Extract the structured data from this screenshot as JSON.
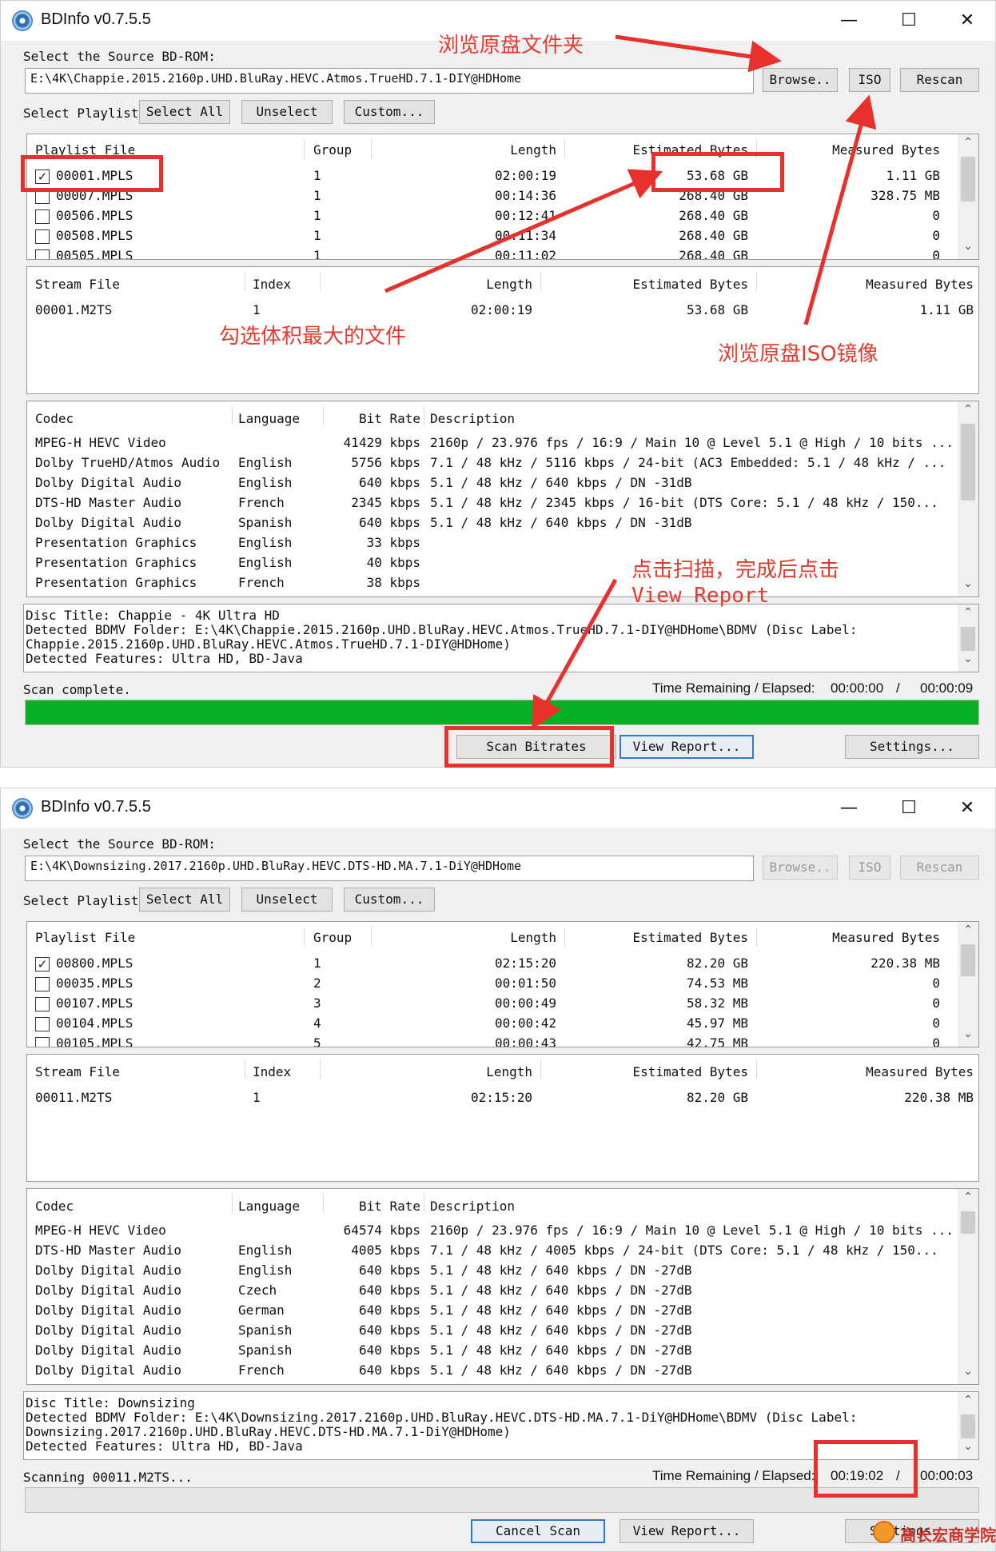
{
  "window1": {
    "title": "BDInfo v0.7.5.5",
    "source_label": "Select the Source BD-ROM:",
    "source_path": "E:\\4K\\Chappie.2015.2160p.UHD.BluRay.HEVC.Atmos.TrueHD.7.1-DIY@HDHome",
    "browse": "Browse..",
    "iso": "ISO",
    "rescan": "Rescan",
    "select_playlist_label": "Select Playlist",
    "select_all": "Select All",
    "unselect": "Unselect",
    "custom": "Custom...",
    "playlist_headers": [
      "Playlist File",
      "Group",
      "Length",
      "Estimated Bytes",
      "Measured Bytes"
    ],
    "playlists": [
      {
        "file": "00001.MPLS",
        "group": "1",
        "length": "02:00:19",
        "est": "53.68 GB",
        "meas": "1.11 GB",
        "checked": true
      },
      {
        "file": "00007.MPLS",
        "group": "1",
        "length": "00:14:36",
        "est": "268.40 GB",
        "meas": "328.75 MB",
        "checked": false
      },
      {
        "file": "00506.MPLS",
        "group": "1",
        "length": "00:12:41",
        "est": "268.40 GB",
        "meas": "0",
        "checked": false
      },
      {
        "file": "00508.MPLS",
        "group": "1",
        "length": "00:11:34",
        "est": "268.40 GB",
        "meas": "0",
        "checked": false
      },
      {
        "file": "00505.MPLS",
        "group": "1",
        "length": "00:11:02",
        "est": "268.40 GB",
        "meas": "0",
        "checked": false
      }
    ],
    "stream_headers": [
      "Stream File",
      "Index",
      "Length",
      "Estimated Bytes",
      "Measured Bytes"
    ],
    "streams": [
      {
        "file": "00001.M2TS",
        "index": "1",
        "length": "02:00:19",
        "est": "53.68 GB",
        "meas": "1.11 GB"
      }
    ],
    "codec_headers": [
      "Codec",
      "Language",
      "Bit Rate",
      "Description"
    ],
    "codecs": [
      {
        "codec": "MPEG-H HEVC Video",
        "lang": "",
        "rate": "41429 kbps",
        "desc": "2160p / 23.976 fps / 16:9 / Main 10 @ Level 5.1 @ High / 10 bits ..."
      },
      {
        "codec": "Dolby TrueHD/Atmos Audio",
        "lang": "English",
        "rate": "5756 kbps",
        "desc": "7.1 / 48 kHz /  5116 kbps / 24-bit (AC3 Embedded: 5.1 / 48 kHz / ..."
      },
      {
        "codec": "Dolby Digital Audio",
        "lang": "English",
        "rate": "640 kbps",
        "desc": "5.1 / 48 kHz /   640 kbps / DN -31dB"
      },
      {
        "codec": "DTS-HD Master Audio",
        "lang": "French",
        "rate": "2345 kbps",
        "desc": "5.1 / 48 kHz /  2345 kbps / 16-bit (DTS Core: 5.1 / 48 kHz /  150..."
      },
      {
        "codec": "Dolby Digital Audio",
        "lang": "Spanish",
        "rate": "640 kbps",
        "desc": "5.1 / 48 kHz /   640 kbps / DN -31dB"
      },
      {
        "codec": "Presentation Graphics",
        "lang": "English",
        "rate": "33 kbps",
        "desc": ""
      },
      {
        "codec": "Presentation Graphics",
        "lang": "English",
        "rate": "40 kbps",
        "desc": ""
      },
      {
        "codec": "Presentation Graphics",
        "lang": "French",
        "rate": "38 kbps",
        "desc": ""
      }
    ],
    "info_lines": [
      "Disc Title: Chappie - 4K Ultra HD",
      "Detected BDMV Folder: E:\\4K\\Chappie.2015.2160p.UHD.BluRay.HEVC.Atmos.TrueHD.7.1-DIY@HDHome\\BDMV (Disc Label:",
      "Chappie.2015.2160p.UHD.BluRay.HEVC.Atmos.TrueHD.7.1-DIY@HDHome)",
      "Detected Features: Ultra HD, BD-Java"
    ],
    "status": "Scan complete.",
    "time_label": "Time Remaining / Elapsed:",
    "time_remaining": "00:00:00",
    "time_sep": "/",
    "time_elapsed": "00:00:09",
    "progress": 1.0,
    "scan_button": "Scan Bitrates",
    "view_report": "View Report...",
    "settings": "Settings..."
  },
  "window2": {
    "title": "BDInfo v0.7.5.5",
    "source_label": "Select the Source BD-ROM:",
    "source_path": "E:\\4K\\Downsizing.2017.2160p.UHD.BluRay.HEVC.DTS-HD.MA.7.1-DiY@HDHome",
    "browse": "Browse..",
    "iso": "ISO",
    "rescan": "Rescan",
    "select_playlist_label": "Select Playlist",
    "select_all": "Select All",
    "unselect": "Unselect",
    "custom": "Custom...",
    "playlist_headers": [
      "Playlist File",
      "Group",
      "Length",
      "Estimated Bytes",
      "Measured Bytes"
    ],
    "playlists": [
      {
        "file": "00800.MPLS",
        "group": "1",
        "length": "02:15:20",
        "est": "82.20 GB",
        "meas": "220.38 MB",
        "checked": true
      },
      {
        "file": "00035.MPLS",
        "group": "2",
        "length": "00:01:50",
        "est": "74.53 MB",
        "meas": "0",
        "checked": false
      },
      {
        "file": "00107.MPLS",
        "group": "3",
        "length": "00:00:49",
        "est": "58.32 MB",
        "meas": "0",
        "checked": false
      },
      {
        "file": "00104.MPLS",
        "group": "4",
        "length": "00:00:42",
        "est": "45.97 MB",
        "meas": "0",
        "checked": false
      },
      {
        "file": "00105.MPLS",
        "group": "5",
        "length": "00:00:43",
        "est": "42.75 MB",
        "meas": "0",
        "checked": false
      }
    ],
    "stream_headers": [
      "Stream File",
      "Index",
      "Length",
      "Estimated Bytes",
      "Measured Bytes"
    ],
    "streams": [
      {
        "file": "00011.M2TS",
        "index": "1",
        "length": "02:15:20",
        "est": "82.20 GB",
        "meas": "220.38 MB"
      }
    ],
    "codec_headers": [
      "Codec",
      "Language",
      "Bit Rate",
      "Description"
    ],
    "codecs": [
      {
        "codec": "MPEG-H HEVC Video",
        "lang": "",
        "rate": "64574 kbps",
        "desc": "2160p / 23.976 fps / 16:9 / Main 10 @ Level 5.1 @ High / 10 bits ..."
      },
      {
        "codec": "DTS-HD Master Audio",
        "lang": "English",
        "rate": "4005 kbps",
        "desc": "7.1 / 48 kHz /  4005 kbps / 24-bit (DTS Core: 5.1 / 48 kHz /  150..."
      },
      {
        "codec": "Dolby Digital Audio",
        "lang": "English",
        "rate": "640 kbps",
        "desc": "5.1 / 48 kHz /   640 kbps / DN -27dB"
      },
      {
        "codec": "Dolby Digital Audio",
        "lang": "Czech",
        "rate": "640 kbps",
        "desc": "5.1 / 48 kHz /   640 kbps / DN -27dB"
      },
      {
        "codec": "Dolby Digital Audio",
        "lang": "German",
        "rate": "640 kbps",
        "desc": "5.1 / 48 kHz /   640 kbps / DN -27dB"
      },
      {
        "codec": "Dolby Digital Audio",
        "lang": "Spanish",
        "rate": "640 kbps",
        "desc": "5.1 / 48 kHz /   640 kbps / DN -27dB"
      },
      {
        "codec": "Dolby Digital Audio",
        "lang": "Spanish",
        "rate": "640 kbps",
        "desc": "5.1 / 48 kHz /   640 kbps / DN -27dB"
      },
      {
        "codec": "Dolby Digital Audio",
        "lang": "French",
        "rate": "640 kbps",
        "desc": "5.1 / 48 kHz /   640 kbps / DN -27dB"
      }
    ],
    "info_lines": [
      "Disc Title: Downsizing",
      "Detected BDMV Folder: E:\\4K\\Downsizing.2017.2160p.UHD.BluRay.HEVC.DTS-HD.MA.7.1-DiY@HDHome\\BDMV (Disc Label:",
      "Downsizing.2017.2160p.UHD.BluRay.HEVC.DTS-HD.MA.7.1-DiY@HDHome)",
      "Detected Features: Ultra HD, BD-Java"
    ],
    "status": "Scanning 00011.M2TS...",
    "time_label": "Time Remaining / Elapsed:",
    "time_remaining": "00:19:02",
    "time_sep": "/",
    "time_elapsed": "00:00:03",
    "progress": 0.0,
    "scan_button": "Cancel Scan",
    "view_report": "View Report...",
    "settings": "Settings..."
  },
  "annotations": {
    "browse_folder": "浏览原盘文件夹",
    "select_largest": "勾选体积最大的文件",
    "browse_iso": "浏览原盘ISO镜像",
    "scan_line1": "点击扫描，完成后点击",
    "scan_line2": "View Report"
  },
  "watermark": "高长宏商学院",
  "colors": {
    "annotation_red": "#e8302c",
    "progress_green": "#06b025",
    "focus_blue": "#2f7ad6"
  }
}
